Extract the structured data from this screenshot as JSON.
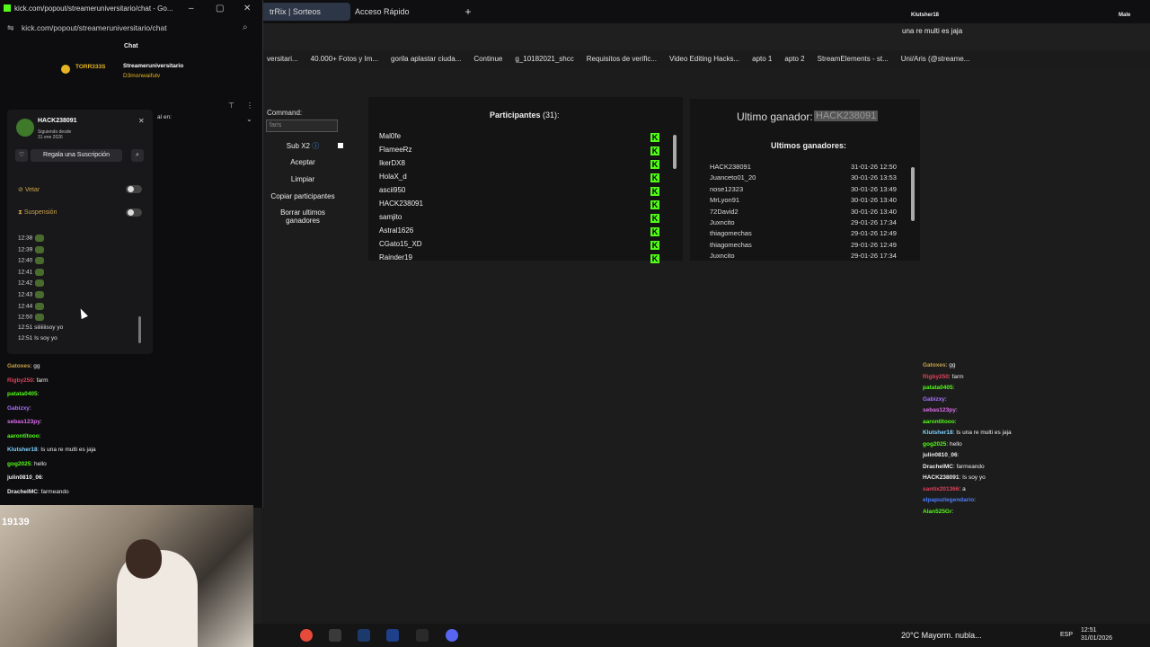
{
  "browser": {
    "tabs": [
      {
        "label": "trRix | Sorteos"
      },
      {
        "label": "Acceso Rápido"
      }
    ],
    "bookmarks": [
      "versitari...",
      "40.000+ Fotos y Im...",
      "gorila aplastar ciuda...",
      "Continue",
      "g_10182021_shcc",
      "Requisitos de verific...",
      "Video Editing Hacks...",
      "apto 1",
      "apto 2",
      "StreamElements - st...",
      "Uni/Aris (@streame..."
    ]
  },
  "top_right": {
    "user": "Klutsher18",
    "label": "Male",
    "message": "una re multi es jaja"
  },
  "giveaway": {
    "command_label": "Command:",
    "command_value": "faris",
    "sub_label": "Sub X2",
    "accept_label": "Aceptar",
    "clear_label": "Limpiar",
    "copy_label": "Copiar participantes",
    "delete_label": "Borrar ultimos ganadores",
    "participants_title": "Participantes",
    "participants_count": "(31):",
    "participants": [
      "Mal0fe",
      "FlameeRz",
      "IkerDX8",
      "HolaX_d",
      "ascii950",
      "HACK238091",
      "samjito",
      "Astral1626",
      "CGato15_XD",
      "Rainder19"
    ],
    "last_winner_label": "Ultimo ganador:",
    "last_winner": "HACK238091",
    "last_winners_title": "Ultimos ganadores:",
    "winners": [
      {
        "name": "HACK238091",
        "date": "31-01-26 12:50"
      },
      {
        "name": "Juanceto01_20",
        "date": "30-01-26 13:53"
      },
      {
        "name": "nose12323",
        "date": "30-01-26 13:49"
      },
      {
        "name": "MrLyon91",
        "date": "30-01-26 13:40"
      },
      {
        "name": "72David2",
        "date": "30-01-26 13:40"
      },
      {
        "name": "Juxncito",
        "date": "29-01-26 17:34"
      },
      {
        "name": "thiagomechas",
        "date": "29-01-26 12:49"
      },
      {
        "name": "thiagomechas",
        "date": "29-01-26 12:49"
      },
      {
        "name": "Juxncito",
        "date": "29-01-26 17:34"
      }
    ]
  },
  "overlay_chat": [
    {
      "user": "Gatoxes",
      "text": ": gg",
      "color": "#c9a14a"
    },
    {
      "user": "Rigby250",
      "text": ": farm",
      "color": "#e0405a"
    },
    {
      "user": "patata0405",
      "text": ":",
      "color": "#53fc18"
    },
    {
      "user": "Gabizxy",
      "text": ":",
      "color": "#a970ff"
    },
    {
      "user": "sebas123py",
      "text": ":",
      "color": "#e06cf0"
    },
    {
      "user": "aarontitooo",
      "text": ":",
      "color": "#53fc18"
    },
    {
      "user": "Klutsher18",
      "text": ": Is una re multi es jaja",
      "color": "#7ed0ff"
    },
    {
      "user": "gog2025",
      "text": ": hello",
      "color": "#53fc18"
    },
    {
      "user": "julin0810_06",
      "text": ":",
      "color": "#eee"
    },
    {
      "user": "DrachelMC",
      "text": ": farmeando",
      "color": "#eee"
    },
    {
      "user": "HACK238091",
      "text": ": Is soy yo",
      "color": "#eee"
    },
    {
      "user": "santix201366",
      "text": ": a",
      "color": "#e0405a"
    },
    {
      "user": "elpapuzlegendario",
      "text": ":",
      "color": "#4d7fff"
    },
    {
      "user": "Alan525Gr",
      "text": ":",
      "color": "#53fc18"
    }
  ],
  "popup": {
    "title": "kick.com/popout/streameruniversitario/chat - Go...",
    "url": "kick.com/popout/streameruniversitario/chat",
    "chat_label": "Chat",
    "pinned_user1": "TORR333S",
    "pinned_user2": "Streameruniversitario",
    "pinned_user3": "D3monwaifutv",
    "pinned_label": "al en:",
    "card": {
      "username": "HACK238091",
      "since_label": "Siguiendo desde",
      "since_date": "31 ene 2026",
      "gift_label": "Regala una Suscripción",
      "ban_label": "Vetar",
      "timeout_label": "Suspensión",
      "log_times": [
        "12:38",
        "12:39",
        "12:40",
        "12:41",
        "12:42",
        "12:43",
        "12:44",
        "12:50"
      ],
      "log_text1": "12:51 siiiiiiisoy yo",
      "log_text2": "12:51 Is soy yo"
    },
    "chat": [
      {
        "user": "Gatoxes",
        "text": ": gg",
        "color": "#c9a14a"
      },
      {
        "user": "Rigby250",
        "text": ": farm",
        "color": "#e0405a"
      },
      {
        "user": "patata0405",
        "text": ":",
        "color": "#53fc18"
      },
      {
        "user": "Gabizxy",
        "text": ":",
        "color": "#a970ff"
      },
      {
        "user": "sebas123py",
        "text": ":",
        "color": "#e06cf0"
      },
      {
        "user": "aarontitooo",
        "text": ":",
        "color": "#53fc18"
      },
      {
        "user": "Klutsher18",
        "text": ": Is una re multi es jaja",
        "color": "#7ed0ff"
      },
      {
        "user": "gog2025",
        "text": ": hello",
        "color": "#53fc18"
      },
      {
        "user": "julin0810_06",
        "text": ":",
        "color": "#eee"
      },
      {
        "user": "DrachelMC",
        "text": ": farmeando",
        "color": "#eee"
      }
    ]
  },
  "webcam": {
    "view_count": "19139"
  },
  "taskbar": {
    "weather": "20°C  Mayorm. nubla...",
    "lang": "ESP",
    "time": "12:51",
    "date": "31/01/2026"
  }
}
